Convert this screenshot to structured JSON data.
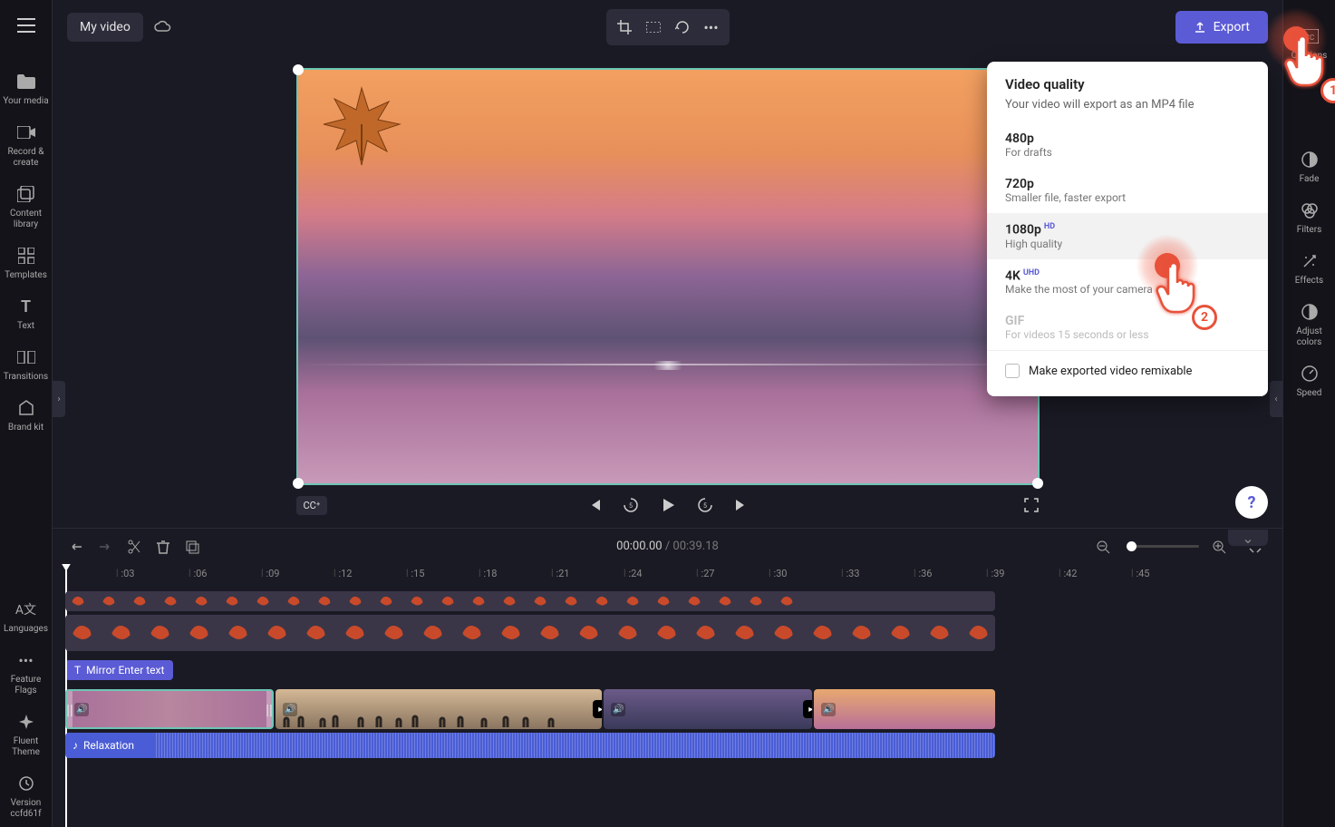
{
  "topbar": {
    "title": "My video",
    "export_label": "Export"
  },
  "left_sidebar": [
    {
      "icon": "folder",
      "label": "Your media"
    },
    {
      "icon": "record",
      "label": "Record & create"
    },
    {
      "icon": "library",
      "label": "Content library"
    },
    {
      "icon": "templates",
      "label": "Templates"
    },
    {
      "icon": "text",
      "label": "Text"
    },
    {
      "icon": "transitions",
      "label": "Transitions"
    },
    {
      "icon": "brandkit",
      "label": "Brand kit"
    }
  ],
  "left_sidebar_bottom": [
    {
      "icon": "languages",
      "label": "Languages"
    },
    {
      "icon": "dots",
      "label": "Feature Flags"
    },
    {
      "icon": "theme",
      "label": "Fluent Theme"
    },
    {
      "icon": "clock",
      "label": "Version ccfd61f"
    }
  ],
  "right_sidebar": [
    {
      "icon": "cc",
      "label": "Captions"
    },
    {
      "icon": "fade",
      "label": "Fade"
    },
    {
      "icon": "filters",
      "label": "Filters"
    },
    {
      "icon": "effects",
      "label": "Effects"
    },
    {
      "icon": "adjust",
      "label": "Adjust colors"
    },
    {
      "icon": "speed",
      "label": "Speed"
    }
  ],
  "export_panel": {
    "title": "Video quality",
    "subtitle": "Your video will export as an MP4 file",
    "options": [
      {
        "title": "480p",
        "desc": "For drafts",
        "badge": ""
      },
      {
        "title": "720p",
        "desc": "Smaller file, faster export",
        "badge": ""
      },
      {
        "title": "1080p",
        "desc": "High quality",
        "badge": "HD"
      },
      {
        "title": "4K",
        "desc": "Make the most of your camera",
        "badge": "UHD"
      },
      {
        "title": "GIF",
        "desc": "For videos 15 seconds or less",
        "badge": ""
      }
    ],
    "remixable_label": "Make exported video remixable"
  },
  "timeline": {
    "current": "00:00.00",
    "total": "00:39.18",
    "ruler": [
      ":03",
      ":06",
      ":09",
      ":12",
      ":15",
      ":18",
      ":21",
      ":24",
      ":27",
      ":30",
      ":33",
      ":36",
      ":39",
      ":42",
      ":45"
    ],
    "text_track_label": "Mirror Enter text",
    "audio_label": "Relaxation"
  },
  "annotations": {
    "one": "1",
    "two": "2"
  }
}
